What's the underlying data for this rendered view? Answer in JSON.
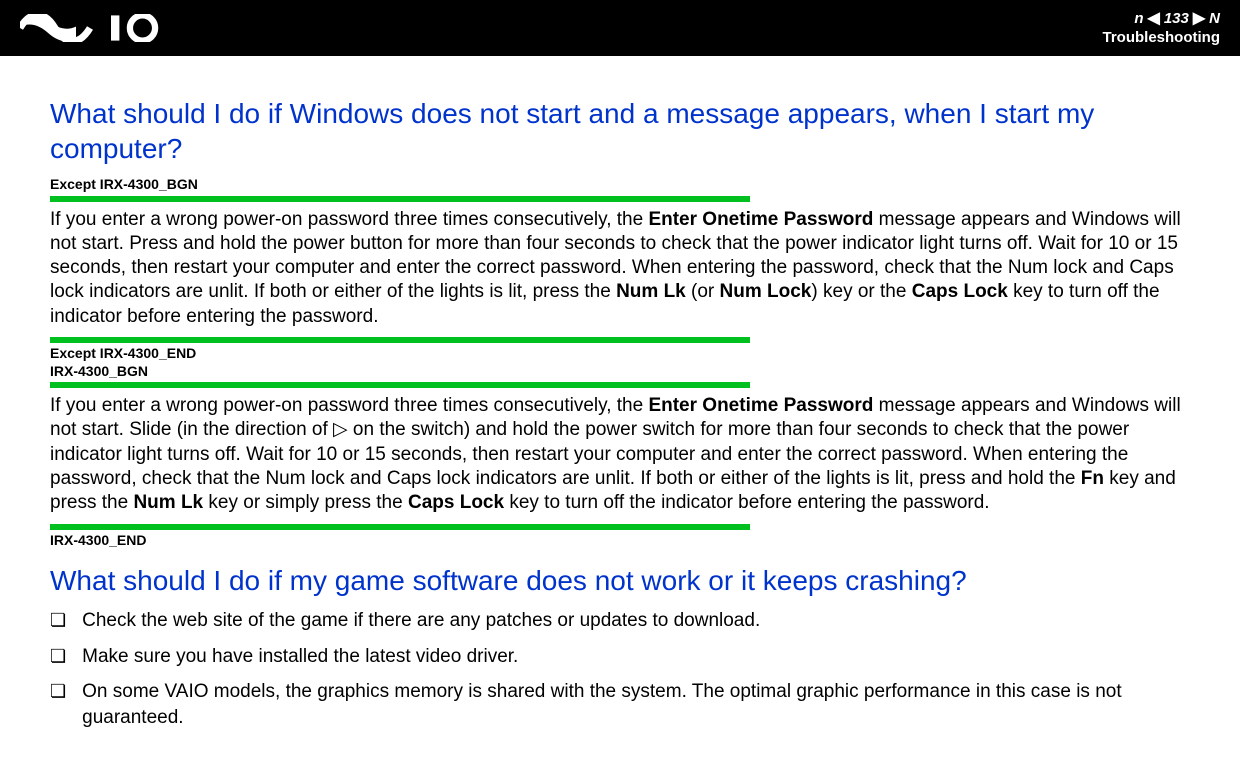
{
  "header": {
    "page_number": "133",
    "n_label": "n",
    "N_label": "N",
    "section": "Troubleshooting"
  },
  "q1": {
    "title": "What should I do if Windows does not start and a message appears, when I start my computer?",
    "tag1": "Except IRX-4300_BGN",
    "p1_a": "If you enter a wrong power-on password three times consecutively, the ",
    "p1_b": "Enter Onetime Password",
    "p1_c": " message appears and Windows will not start. Press and hold the power button for more than four seconds to check that the power indicator light turns off. Wait for 10 or 15 seconds, then restart your computer and enter the correct password. When entering the password, check that the Num lock and Caps lock indicators are unlit. If both or either of the lights is lit, press the ",
    "p1_d": "Num Lk",
    "p1_e": " (or ",
    "p1_f": "Num Lock",
    "p1_g": ") key or the ",
    "p1_h": "Caps Lock",
    "p1_i": " key to turn off the indicator before entering the password.",
    "tag2a": "Except IRX-4300_END",
    "tag2b": "IRX-4300_BGN",
    "p2_a": "If you enter a wrong power-on password three times consecutively, the ",
    "p2_b": "Enter Onetime Password",
    "p2_c": " message appears and Windows will not start. Slide (in the direction of ▷ on the switch) and hold the power switch for more than four seconds to check that the power indicator light turns off. Wait for 10 or 15 seconds, then restart your computer and enter the correct password. When entering the password, check that the Num lock and Caps lock indicators are unlit. If both or either of the lights is lit, press and hold the ",
    "p2_d": "Fn",
    "p2_e": " key and press the ",
    "p2_f": "Num Lk",
    "p2_g": " key or simply press the ",
    "p2_h": "Caps Lock",
    "p2_i": " key to turn off the indicator before entering the password.",
    "tag3": "IRX-4300_END"
  },
  "q2": {
    "title": "What should I do if my game software does not work or it keeps crashing?",
    "items": [
      "Check the web site of the game if there are any patches or updates to download.",
      "Make sure you have installed the latest video driver.",
      "On some VAIO models, the graphics memory is shared with the system. The optimal graphic performance in this case is not guaranteed."
    ]
  }
}
